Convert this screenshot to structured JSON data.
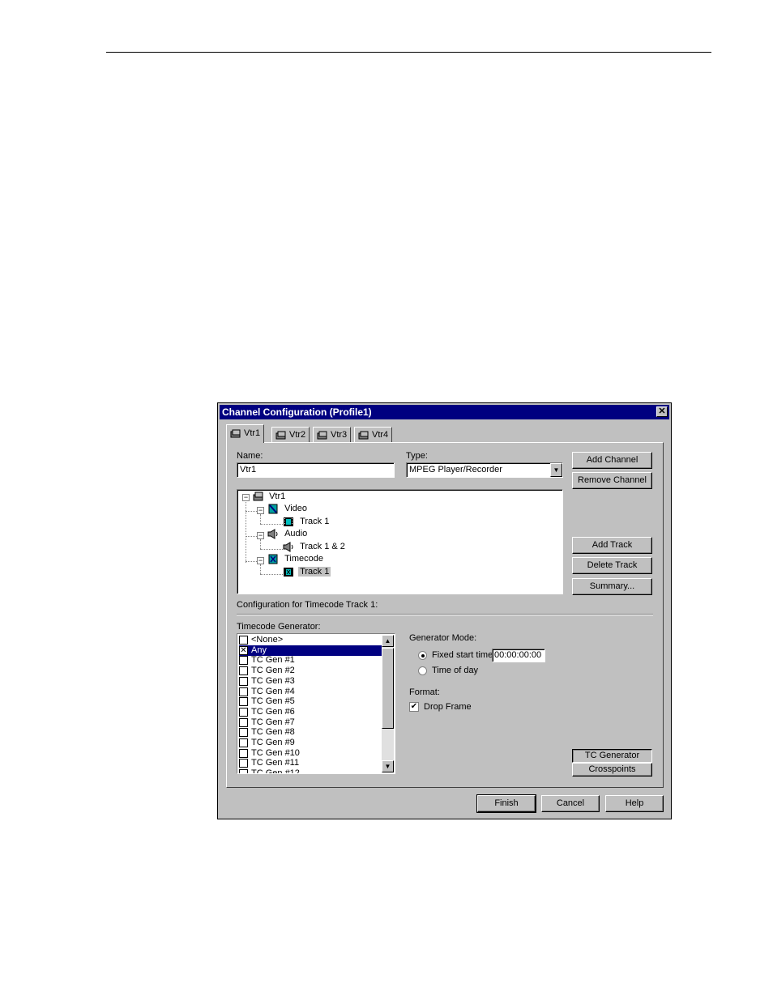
{
  "dialog": {
    "title": "Channel Configuration (Profile1)",
    "close_glyph": "✕"
  },
  "tabs": [
    {
      "label": "Vtr1",
      "icon": "vtr-icon"
    },
    {
      "label": "Vtr2",
      "icon": "vtr-icon"
    },
    {
      "label": "Vtr3",
      "icon": "vtr-icon"
    },
    {
      "label": "Vtr4",
      "icon": "vtr-icon"
    }
  ],
  "form": {
    "name_label": "Name:",
    "name_value": "Vtr1",
    "type_label": "Type:",
    "type_value": "MPEG Player/Recorder"
  },
  "buttons": {
    "add_channel": "Add Channel",
    "remove_channel": "Remove Channel",
    "add_track": "Add Track",
    "delete_track": "Delete Track",
    "summary": "Summary...",
    "tc_generator": "TC Generator",
    "crosspoints": "Crosspoints",
    "finish": "Finish",
    "cancel": "Cancel",
    "help": "Help"
  },
  "tree": {
    "root": "Vtr1",
    "video": "Video",
    "video_track": "Track 1",
    "audio": "Audio",
    "audio_track": "Track 1 & 2",
    "timecode": "Timecode",
    "timecode_track": "Track 1"
  },
  "config_heading": "Configuration for Timecode Track 1:",
  "timecode_generator": {
    "label": "Timecode Generator:",
    "items": [
      {
        "label": "<None>",
        "checked": false,
        "selected": false
      },
      {
        "label": "Any",
        "checked": true,
        "selected": true
      },
      {
        "label": "TC Gen #1",
        "checked": false,
        "selected": false
      },
      {
        "label": "TC Gen #2",
        "checked": false,
        "selected": false
      },
      {
        "label": "TC Gen #3",
        "checked": false,
        "selected": false
      },
      {
        "label": "TC Gen #4",
        "checked": false,
        "selected": false
      },
      {
        "label": "TC Gen #5",
        "checked": false,
        "selected": false
      },
      {
        "label": "TC Gen #6",
        "checked": false,
        "selected": false
      },
      {
        "label": "TC Gen #7",
        "checked": false,
        "selected": false
      },
      {
        "label": "TC Gen #8",
        "checked": false,
        "selected": false
      },
      {
        "label": "TC Gen #9",
        "checked": false,
        "selected": false
      },
      {
        "label": "TC Gen #10",
        "checked": false,
        "selected": false
      },
      {
        "label": "TC Gen #11",
        "checked": false,
        "selected": false
      },
      {
        "label": "TC Gen #12",
        "checked": false,
        "selected": false
      }
    ]
  },
  "generator_mode": {
    "label": "Generator Mode:",
    "fixed_start_label": "Fixed start time",
    "fixed_start_value": "00:00:00:00",
    "time_of_day_label": "Time of day",
    "selected": "fixed"
  },
  "format": {
    "label": "Format:",
    "drop_frame_label": "Drop Frame",
    "drop_frame_checked": true
  }
}
